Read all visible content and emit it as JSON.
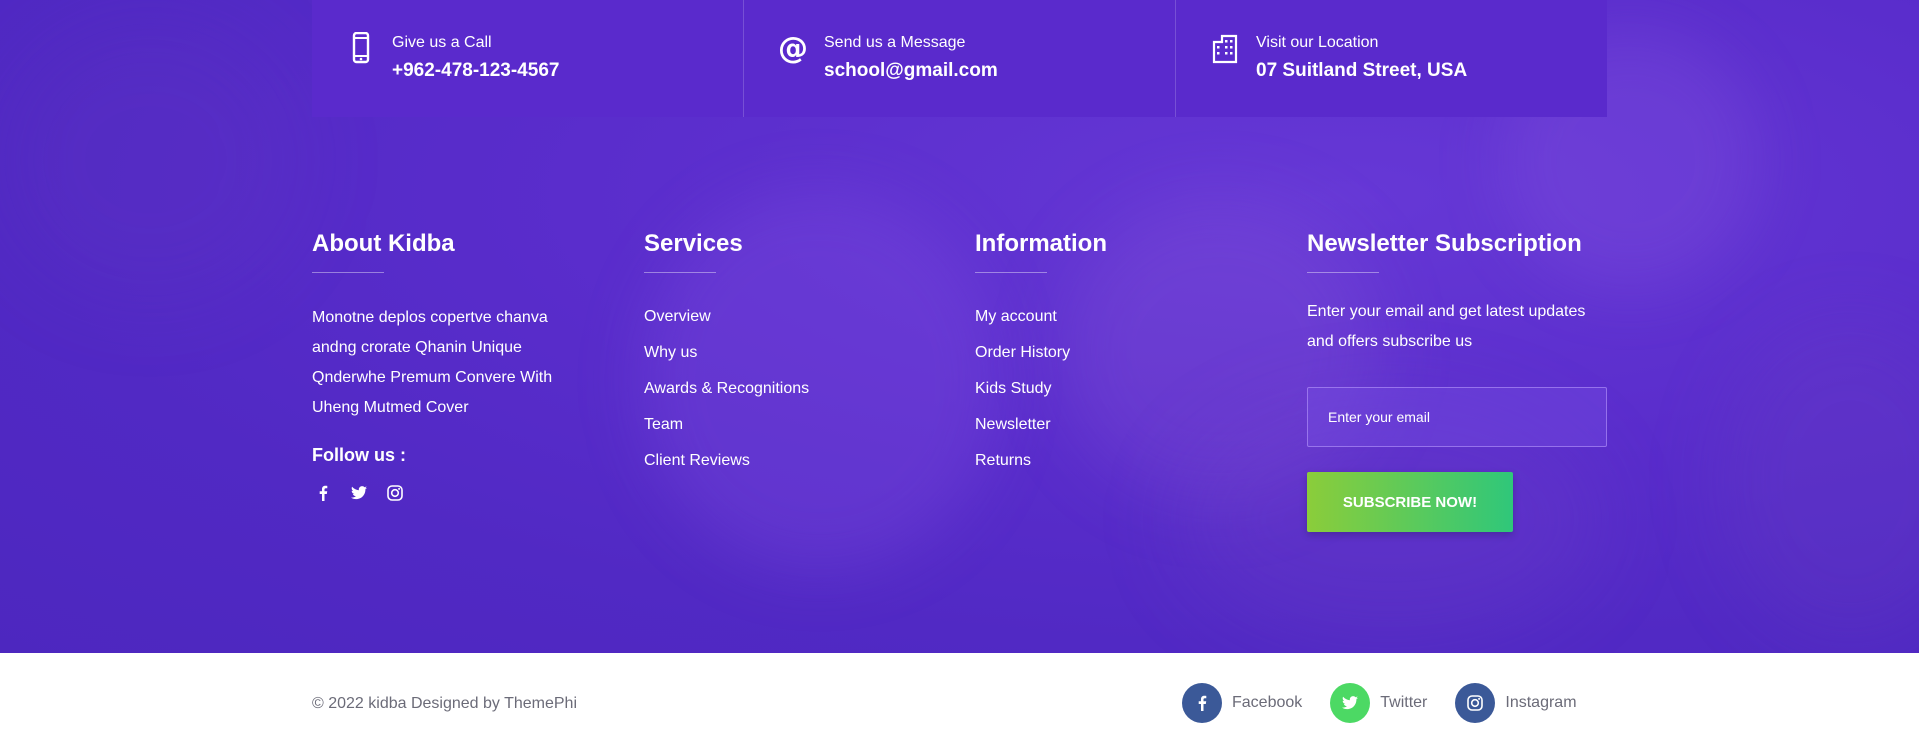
{
  "contact": [
    {
      "icon": "phone-icon",
      "label": "Give us a Call",
      "value": "+962-478-123-4567"
    },
    {
      "icon": "at-icon",
      "label": "Send us a Message",
      "value": "school@gmail.com"
    },
    {
      "icon": "building-icon",
      "label": "Visit our Location",
      "value": "07 Suitland Street, USA"
    }
  ],
  "about": {
    "title": "About Kidba",
    "text": "Monotne deplos copertve chanva andng crorate Qhanin Unique Qnderwhe Premum Convere With Uheng Mutmed Cover",
    "follow_label": "Follow us :"
  },
  "services": {
    "title": "Services",
    "links": [
      "Overview",
      "Why us",
      "Awards & Recognitions",
      "Team",
      "Client Reviews"
    ]
  },
  "information": {
    "title": "Information",
    "links": [
      "My account",
      "Order History",
      "Kids Study",
      "Newsletter",
      "Returns"
    ]
  },
  "newsletter": {
    "title": "Newsletter Subscription",
    "text": "Enter your email and get latest updates and offers subscribe us",
    "placeholder": "Enter your email",
    "button": "SUBSCRIBE NOW!"
  },
  "bottom": {
    "copyright": "© 2022 kidba Designed by ThemePhi",
    "socials": [
      {
        "label": "Facebook",
        "color": "#3b5998",
        "icon": "facebook-icon"
      },
      {
        "label": "Twitter",
        "color": "#4cd964",
        "icon": "twitter-icon"
      },
      {
        "label": "Instagram",
        "color": "#3b5998",
        "icon": "instagram-icon"
      }
    ]
  },
  "colors": {
    "background": "#5a2dcc",
    "accent_start": "#8bcd3a",
    "accent_end": "#2fc77a"
  }
}
